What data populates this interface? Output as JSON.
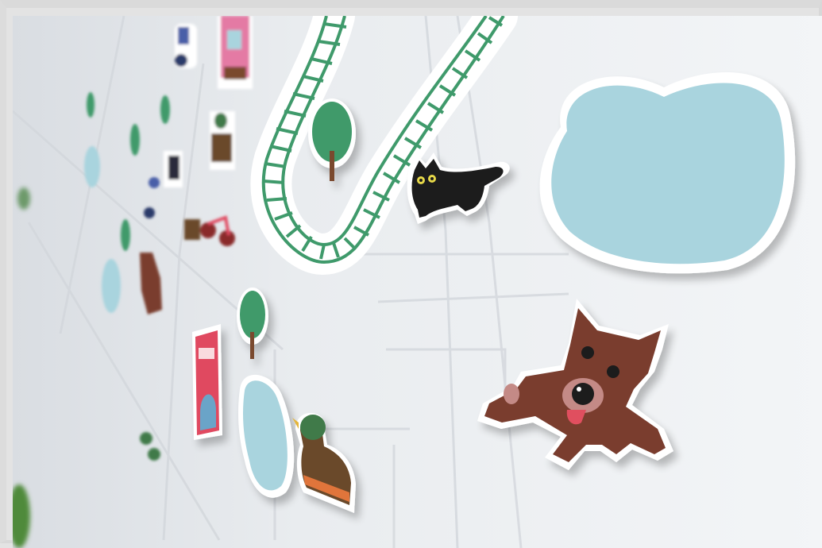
{
  "photo": {
    "subject": "",
    "colors": {
      "wall": "#eef0f3",
      "wall_shadow": "#d7dbe0",
      "pond": "#a9d4de",
      "track": "#3f9a6b",
      "tree": "#3f9a6b",
      "trunk": "#7a4a2f",
      "dog": "#7a3e2f",
      "cat": "#1c1c1c",
      "tongue": "#e0505f",
      "frame": "#dadada"
    }
  }
}
